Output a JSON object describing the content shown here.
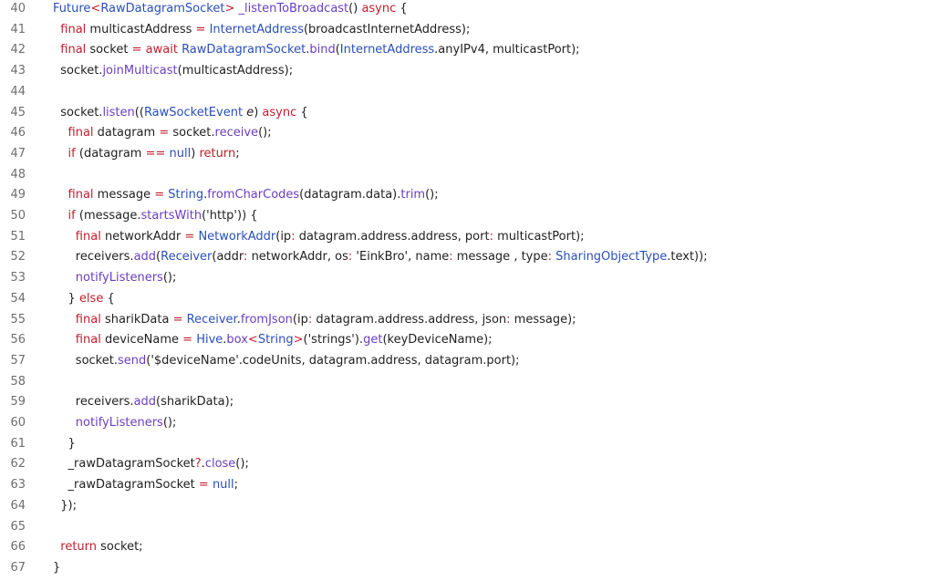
{
  "lines": [
    {
      "n": "40",
      "tokens": [
        [
          "ty",
          "Future"
        ],
        [
          "op",
          "<"
        ],
        [
          "ty",
          "RawDatagramSocket"
        ],
        [
          "op",
          ">"
        ],
        [
          "nm",
          " "
        ],
        [
          "fn",
          "_listenToBroadcast"
        ],
        [
          "nm",
          "() "
        ],
        [
          "kw",
          "async"
        ],
        [
          "nm",
          " {"
        ]
      ]
    },
    {
      "n": "41",
      "tokens": [
        [
          "nm",
          "  "
        ],
        [
          "kw",
          "final"
        ],
        [
          "nm",
          " multicastAddress "
        ],
        [
          "op",
          "="
        ],
        [
          "nm",
          " "
        ],
        [
          "ty",
          "InternetAddress"
        ],
        [
          "nm",
          "(broadcastInternetAddress);"
        ]
      ]
    },
    {
      "n": "42",
      "tokens": [
        [
          "nm",
          "  "
        ],
        [
          "kw",
          "final"
        ],
        [
          "nm",
          " socket "
        ],
        [
          "op",
          "="
        ],
        [
          "nm",
          " "
        ],
        [
          "kw",
          "await"
        ],
        [
          "nm",
          " "
        ],
        [
          "ty",
          "RawDatagramSocket"
        ],
        [
          "nm",
          "."
        ],
        [
          "fn",
          "bind"
        ],
        [
          "nm",
          "("
        ],
        [
          "ty",
          "InternetAddress"
        ],
        [
          "nm",
          ".anyIPv4, multicastPort);"
        ]
      ]
    },
    {
      "n": "43",
      "tokens": [
        [
          "nm",
          "  socket."
        ],
        [
          "fn",
          "joinMulticast"
        ],
        [
          "nm",
          "(multicastAddress);"
        ]
      ]
    },
    {
      "n": "44",
      "tokens": []
    },
    {
      "n": "45",
      "tokens": [
        [
          "nm",
          "  socket."
        ],
        [
          "fn",
          "listen"
        ],
        [
          "nm",
          "(("
        ],
        [
          "ty",
          "RawSocketEvent"
        ],
        [
          "nm",
          " "
        ],
        [
          "it",
          "e"
        ],
        [
          "nm",
          ") "
        ],
        [
          "kw",
          "async"
        ],
        [
          "nm",
          " {"
        ]
      ]
    },
    {
      "n": "46",
      "tokens": [
        [
          "nm",
          "    "
        ],
        [
          "kw",
          "final"
        ],
        [
          "nm",
          " datagram "
        ],
        [
          "op",
          "="
        ],
        [
          "nm",
          " socket."
        ],
        [
          "fn",
          "receive"
        ],
        [
          "nm",
          "();"
        ]
      ]
    },
    {
      "n": "47",
      "tokens": [
        [
          "nm",
          "    "
        ],
        [
          "kw",
          "if"
        ],
        [
          "nm",
          " (datagram "
        ],
        [
          "op",
          "=="
        ],
        [
          "nm",
          " "
        ],
        [
          "ty",
          "null"
        ],
        [
          "nm",
          ") "
        ],
        [
          "kw",
          "return"
        ],
        [
          "nm",
          ";"
        ]
      ]
    },
    {
      "n": "48",
      "tokens": []
    },
    {
      "n": "49",
      "tokens": [
        [
          "nm",
          "    "
        ],
        [
          "kw",
          "final"
        ],
        [
          "nm",
          " message "
        ],
        [
          "op",
          "="
        ],
        [
          "nm",
          " "
        ],
        [
          "ty",
          "String"
        ],
        [
          "nm",
          "."
        ],
        [
          "fn",
          "fromCharCodes"
        ],
        [
          "nm",
          "(datagram.data)."
        ],
        [
          "fn",
          "trim"
        ],
        [
          "nm",
          "();"
        ]
      ]
    },
    {
      "n": "50",
      "tokens": [
        [
          "nm",
          "    "
        ],
        [
          "kw",
          "if"
        ],
        [
          "nm",
          " (message."
        ],
        [
          "fn",
          "startsWith"
        ],
        [
          "nm",
          "("
        ],
        [
          "st",
          "'http'"
        ],
        [
          "nm",
          ")) {"
        ]
      ]
    },
    {
      "n": "51",
      "tokens": [
        [
          "nm",
          "      "
        ],
        [
          "kw",
          "final"
        ],
        [
          "nm",
          " networkAddr "
        ],
        [
          "op",
          "="
        ],
        [
          "nm",
          " "
        ],
        [
          "ty",
          "NetworkAddr"
        ],
        [
          "nm",
          "("
        ],
        [
          "pr",
          "ip"
        ],
        [
          "op",
          ":"
        ],
        [
          "nm",
          " datagram.address.address, "
        ],
        [
          "pr",
          "port"
        ],
        [
          "op",
          ":"
        ],
        [
          "nm",
          " multicastPort);"
        ]
      ]
    },
    {
      "n": "52",
      "tokens": [
        [
          "nm",
          "      receivers."
        ],
        [
          "fn",
          "add"
        ],
        [
          "nm",
          "("
        ],
        [
          "ty",
          "Receiver"
        ],
        [
          "nm",
          "("
        ],
        [
          "pr",
          "addr"
        ],
        [
          "op",
          ":"
        ],
        [
          "nm",
          " networkAddr, "
        ],
        [
          "pr",
          "os"
        ],
        [
          "op",
          ":"
        ],
        [
          "nm",
          " "
        ],
        [
          "st",
          "'EinkBro'"
        ],
        [
          "nm",
          ", "
        ],
        [
          "pr",
          "name"
        ],
        [
          "op",
          ":"
        ],
        [
          "nm",
          " message , "
        ],
        [
          "pr",
          "type"
        ],
        [
          "op",
          ":"
        ],
        [
          "nm",
          " "
        ],
        [
          "ty",
          "SharingObjectType"
        ],
        [
          "nm",
          ".text));"
        ]
      ]
    },
    {
      "n": "53",
      "tokens": [
        [
          "nm",
          "      "
        ],
        [
          "fn",
          "notifyListeners"
        ],
        [
          "nm",
          "();"
        ]
      ]
    },
    {
      "n": "54",
      "tokens": [
        [
          "nm",
          "    } "
        ],
        [
          "kw",
          "else"
        ],
        [
          "nm",
          " {"
        ]
      ]
    },
    {
      "n": "55",
      "tokens": [
        [
          "nm",
          "      "
        ],
        [
          "kw",
          "final"
        ],
        [
          "nm",
          " sharikData "
        ],
        [
          "op",
          "="
        ],
        [
          "nm",
          " "
        ],
        [
          "ty",
          "Receiver"
        ],
        [
          "nm",
          "."
        ],
        [
          "fn",
          "fromJson"
        ],
        [
          "nm",
          "("
        ],
        [
          "pr",
          "ip"
        ],
        [
          "op",
          ":"
        ],
        [
          "nm",
          " datagram.address.address, "
        ],
        [
          "pr",
          "json"
        ],
        [
          "op",
          ":"
        ],
        [
          "nm",
          " message);"
        ]
      ]
    },
    {
      "n": "56",
      "tokens": [
        [
          "nm",
          "      "
        ],
        [
          "kw",
          "final"
        ],
        [
          "nm",
          " deviceName "
        ],
        [
          "op",
          "="
        ],
        [
          "nm",
          " "
        ],
        [
          "ty",
          "Hive"
        ],
        [
          "nm",
          "."
        ],
        [
          "fn",
          "box"
        ],
        [
          "op",
          "<"
        ],
        [
          "ty",
          "String"
        ],
        [
          "op",
          ">"
        ],
        [
          "nm",
          "("
        ],
        [
          "st",
          "'strings'"
        ],
        [
          "nm",
          ")."
        ],
        [
          "fn",
          "get"
        ],
        [
          "nm",
          "(keyDeviceName);"
        ]
      ]
    },
    {
      "n": "57",
      "tokens": [
        [
          "nm",
          "      socket."
        ],
        [
          "fn",
          "send"
        ],
        [
          "nm",
          "("
        ],
        [
          "st",
          "'$deviceName'"
        ],
        [
          "nm",
          ".codeUnits, datagram.address, datagram.port);"
        ]
      ]
    },
    {
      "n": "58",
      "tokens": []
    },
    {
      "n": "59",
      "tokens": [
        [
          "nm",
          "      receivers."
        ],
        [
          "fn",
          "add"
        ],
        [
          "nm",
          "(sharikData);"
        ]
      ]
    },
    {
      "n": "60",
      "tokens": [
        [
          "nm",
          "      "
        ],
        [
          "fn",
          "notifyListeners"
        ],
        [
          "nm",
          "();"
        ]
      ]
    },
    {
      "n": "61",
      "tokens": [
        [
          "nm",
          "    }"
        ]
      ]
    },
    {
      "n": "62",
      "tokens": [
        [
          "nm",
          "    _rawDatagramSocket"
        ],
        [
          "op",
          "?"
        ],
        [
          "nm",
          "."
        ],
        [
          "fn",
          "close"
        ],
        [
          "nm",
          "();"
        ]
      ]
    },
    {
      "n": "63",
      "tokens": [
        [
          "nm",
          "    _rawDatagramSocket "
        ],
        [
          "op",
          "="
        ],
        [
          "nm",
          " "
        ],
        [
          "ty",
          "null"
        ],
        [
          "nm",
          ";"
        ]
      ]
    },
    {
      "n": "64",
      "tokens": [
        [
          "nm",
          "  });"
        ]
      ]
    },
    {
      "n": "65",
      "tokens": []
    },
    {
      "n": "66",
      "tokens": [
        [
          "nm",
          "  "
        ],
        [
          "kw",
          "return"
        ],
        [
          "nm",
          " socket;"
        ]
      ]
    },
    {
      "n": "67",
      "tokens": [
        [
          "nm",
          "}"
        ]
      ]
    }
  ],
  "colors": {
    "keyword": "#c0202f",
    "type": "#2a4fb8",
    "function": "#6a3ebf",
    "text": "#1f1f1f",
    "line_number": "#6e6e6e",
    "background": "#ffffff"
  }
}
